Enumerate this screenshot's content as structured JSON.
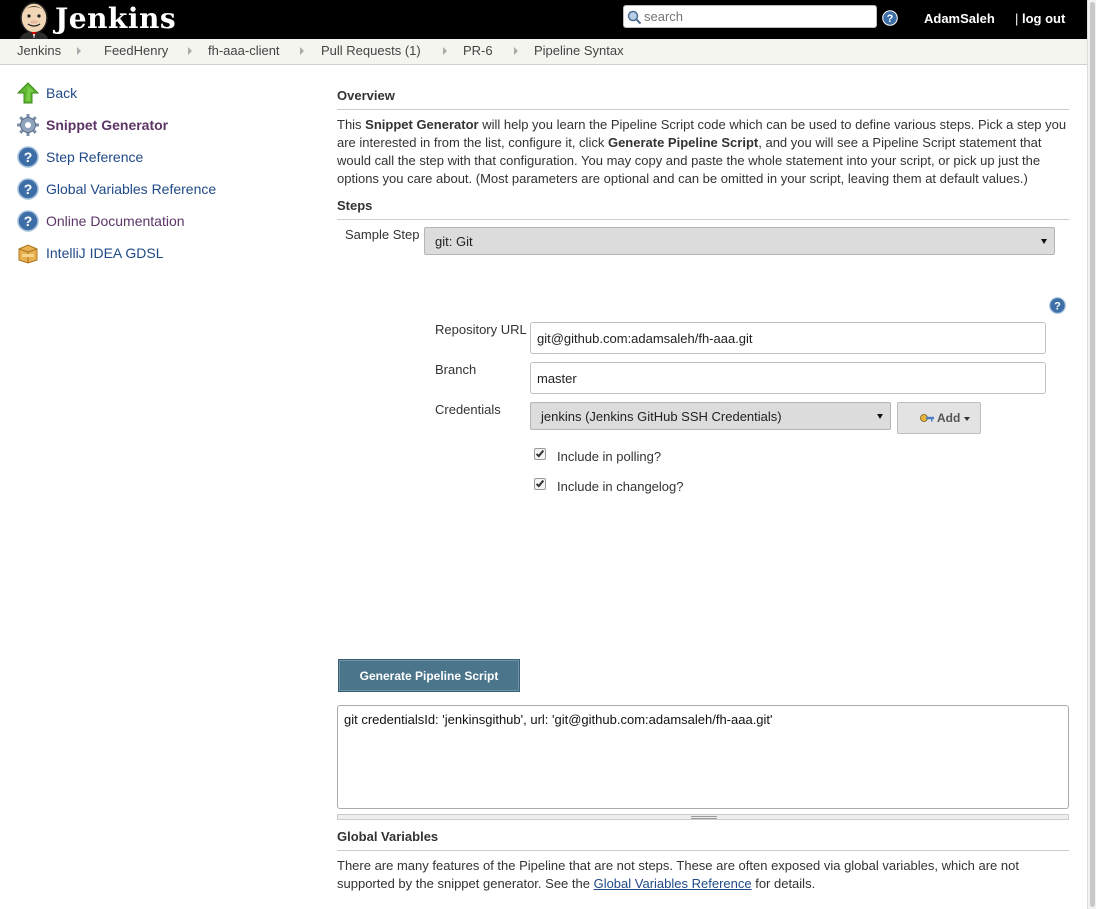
{
  "header": {
    "logo_text": "Jenkins",
    "search_placeholder": "search",
    "user": "AdamSaleh",
    "logout_sep": "|",
    "logout": "log out"
  },
  "breadcrumbs": [
    "Jenkins",
    "FeedHenry",
    "fh-aaa-client",
    "Pull Requests (1)",
    "PR-6",
    "Pipeline Syntax"
  ],
  "tasks": [
    {
      "label": "Back",
      "icon": "up-arrow-icon"
    },
    {
      "label": "Snippet Generator",
      "icon": "gear-icon"
    },
    {
      "label": "Step Reference",
      "icon": "help-icon"
    },
    {
      "label": "Global Variables Reference",
      "icon": "help-icon"
    },
    {
      "label": "Online Documentation",
      "icon": "help-icon"
    },
    {
      "label": "IntelliJ IDEA GDSL",
      "icon": "package-icon"
    }
  ],
  "overview": {
    "heading": "Overview",
    "t1": "This ",
    "b1": "Snippet Generator",
    "t2": " will help you learn the Pipeline Script code which can be used to define various steps. Pick a step you are interested in from the list, configure it, click ",
    "b2": "Generate Pipeline Script",
    "t3": ", and you will see a Pipeline Script statement that would call the step with that configuration. You may copy and paste the whole statement into your script, or pick up just the options you care about. (Most parameters are optional and can be omitted in your script, leaving them at default values.)"
  },
  "steps": {
    "heading": "Steps",
    "sample_step_label": "Sample Step",
    "sample_step_value": "git: Git"
  },
  "git_form": {
    "repo_label": "Repository URL",
    "repo_value": "git@github.com:adamsaleh/fh-aaa.git",
    "branch_label": "Branch",
    "branch_value": "master",
    "credentials_label": "Credentials",
    "credentials_value": "jenkins (Jenkins GitHub SSH Credentials)",
    "add_label": "Add",
    "polling_label": "Include in polling?",
    "polling_checked": true,
    "changelog_label": "Include in changelog?",
    "changelog_checked": true
  },
  "generate_label": "Generate Pipeline Script",
  "script_output": "git credentialsId: 'jenkinsgithub', url: 'git@github.com:adamsaleh/fh-aaa.git'",
  "global_vars": {
    "heading": "Global Variables",
    "t1": "There are many features of the Pipeline that are not steps. These are often exposed via global variables, which are not supported by the snippet generator. See the ",
    "link": "Global Variables Reference",
    "t2": " for details."
  },
  "colors": {
    "header_bg": "#000000",
    "breadcrumb_bg": "#f5f5f0",
    "link": "#204a87",
    "active_task": "#5c3566",
    "button_bg": "#4b758b"
  }
}
